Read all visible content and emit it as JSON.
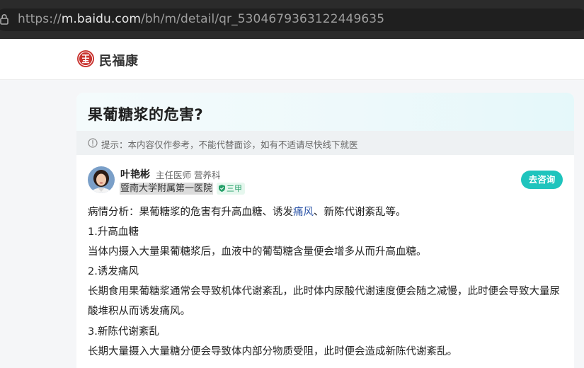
{
  "browser": {
    "url_host": "m.baidu.com",
    "url_path": "/bh/m/detail/qr_5304679363122449635",
    "url_scheme": "https://"
  },
  "site": {
    "name": "民福康",
    "logo_icon": "red-seal-logo-icon"
  },
  "question": {
    "title": "果葡糖浆的危害?",
    "notice": "提示：本内容仅作参考，不能代替面诊，如有不适请尽快线下就医"
  },
  "doctor": {
    "name": "叶艳彬",
    "title": "主任医师 营养科",
    "hospital": "暨南大学附属第一医院",
    "grade": "三甲",
    "consult_label": "去咨询"
  },
  "answer": {
    "intro_prefix": "病情分析：果葡糖浆的危害有升高血糖、诱发",
    "intro_link": "痛风",
    "intro_suffix": "、新陈代谢紊乱等。",
    "h1": "1.升高血糖",
    "p1": "当体内摄入大量果葡糖浆后，血液中的葡萄糖含量便会增多从而升高血糖。",
    "h2": "2.诱发痛风",
    "p2": "长期食用果葡糖浆通常会导致机体代谢紊乱，此时体内尿酸代谢速度便会随之减慢，此时便会导致大量尿酸堆积从而诱发痛风。",
    "h3": "3.新陈代谢紊乱",
    "p3": "长期大量摄入大量糖分便会导致体内部分物质受阻，此时便会造成新陈代谢紊乱。"
  },
  "colors": {
    "accent": "#1fc4bd",
    "link": "#2e56a8",
    "badge": "#26a06a"
  }
}
